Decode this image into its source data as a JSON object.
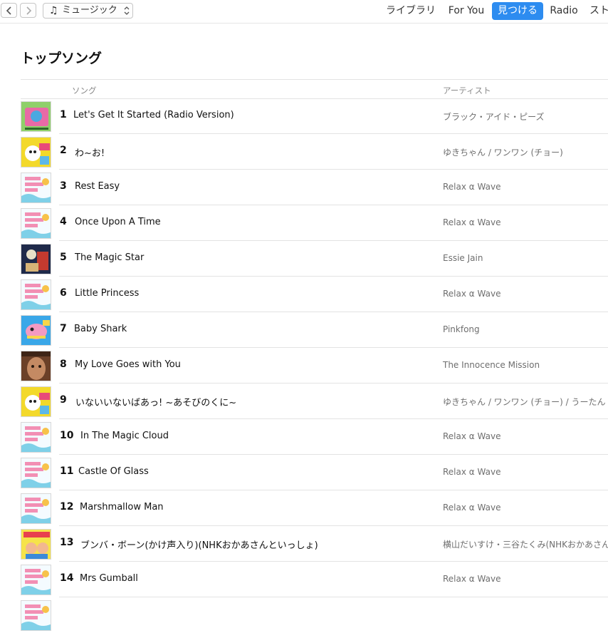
{
  "toolbar": {
    "back_icon": "chevron-left-icon",
    "forward_icon": "chevron-right-icon",
    "media_icon": "music-note-icon",
    "media_label": "ミュージック",
    "tabs": [
      {
        "label": "ライブラリ",
        "active": false
      },
      {
        "label": "For You",
        "active": false
      },
      {
        "label": "見つける",
        "active": true
      },
      {
        "label": "Radio",
        "active": false
      },
      {
        "label": "スト",
        "active": false
      }
    ],
    "accent_color": "#2d8cf0"
  },
  "page": {
    "title": "トップソング"
  },
  "columns": {
    "song": "ソング",
    "artist": "アーティスト"
  },
  "songs": [
    {
      "rank": "1",
      "title": "Let's Get It Started (Radio Version)",
      "artist": "ブラック・アイド・ピーズ",
      "art": "green"
    },
    {
      "rank": "2",
      "title": "わ~お!",
      "artist": "ゆきちゃん / ワンワン (チョー)",
      "art": "yellow"
    },
    {
      "rank": "3",
      "title": "Rest Easy",
      "artist": "Relax α Wave",
      "art": "relax"
    },
    {
      "rank": "4",
      "title": "Once Upon A Time",
      "artist": "Relax α Wave",
      "art": "relax"
    },
    {
      "rank": "5",
      "title": "The Magic Star",
      "artist": "Essie Jain",
      "art": "dark"
    },
    {
      "rank": "6",
      "title": "Little Princess",
      "artist": "Relax α Wave",
      "art": "relax"
    },
    {
      "rank": "7",
      "title": "Baby Shark",
      "artist": "Pinkfong",
      "art": "shark"
    },
    {
      "rank": "8",
      "title": "My Love Goes with You",
      "artist": "The Innocence Mission",
      "art": "face"
    },
    {
      "rank": "9",
      "title": "いないいないばあっ! ~あそびのくに~",
      "artist": "ゆきちゃん / ワンワン (チョー) / うーたん (間宮",
      "art": "yellow"
    },
    {
      "rank": "10",
      "title": "In The Magic Cloud",
      "artist": "Relax α Wave",
      "art": "relax"
    },
    {
      "rank": "11",
      "title": "Castle Of Glass",
      "artist": "Relax α Wave",
      "art": "relax"
    },
    {
      "rank": "12",
      "title": "Marshmallow Man",
      "artist": "Relax α Wave",
      "art": "relax"
    },
    {
      "rank": "13",
      "title": "ブンバ・ボーン(かけ声入り)(NHKおかあさんといっしょ)",
      "artist": "横山だいすけ・三谷たくみ(NHKおかあさんといっ",
      "art": "kids"
    },
    {
      "rank": "14",
      "title": "Mrs Gumball",
      "artist": "Relax α Wave",
      "art": "relax"
    },
    {
      "rank": "",
      "title": "",
      "artist": "",
      "art": "relax"
    }
  ]
}
